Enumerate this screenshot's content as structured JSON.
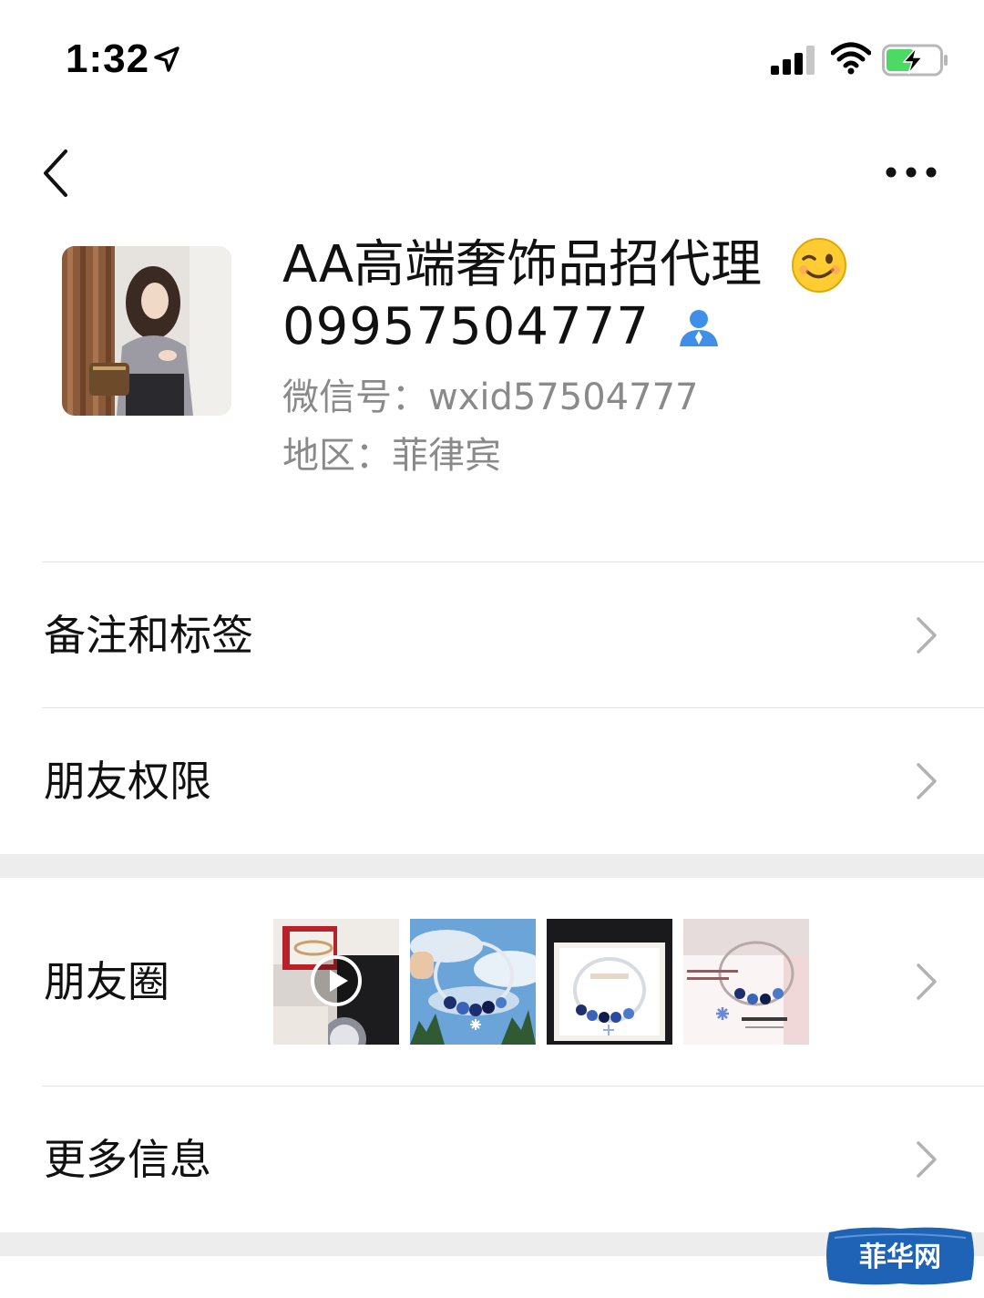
{
  "status_bar": {
    "time": "1:32",
    "icons": [
      "location-arrow-icon",
      "cellular-signal-icon",
      "wifi-icon",
      "battery-charging-icon"
    ]
  },
  "nav": {
    "back_icon": "chevron-left-icon",
    "more_icon": "more-dots-icon"
  },
  "profile": {
    "name": "AA高端奢饰品招代理",
    "name_emoji": "wink-emoji-icon",
    "phone": "09957504777",
    "contact_icon": "contact-person-icon",
    "wechat_id": "微信号：wxid57504777",
    "region": "地区：菲律宾"
  },
  "rows": {
    "notes_tags": "备注和标签",
    "friend_permissions": "朋友权限",
    "moments": "朋友圈",
    "more_info": "更多信息"
  },
  "moments_thumbs": [
    {
      "name": "moments-thumb-video",
      "video": true
    },
    {
      "name": "moments-thumb-bracelet-sky",
      "video": false
    },
    {
      "name": "moments-thumb-bracelet-box",
      "video": false
    },
    {
      "name": "moments-thumb-bracelet-pink",
      "video": false
    }
  ],
  "colors": {
    "accent_blue": "#3f8ee8",
    "secondary_text": "#8a8a8a",
    "divider": "#e3e3e3",
    "band": "#ededed"
  },
  "watermark": {
    "text": "菲华网"
  }
}
